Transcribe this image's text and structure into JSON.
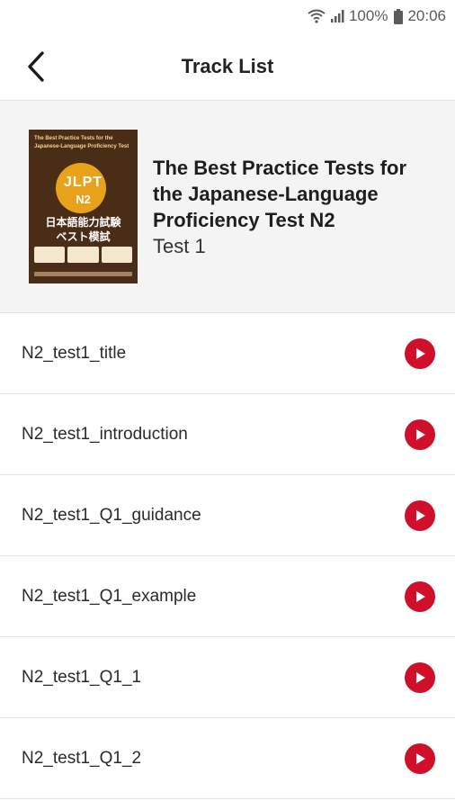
{
  "status_bar": {
    "battery_percent": "100%",
    "time": "20:06",
    "icons": [
      "wifi-icon",
      "signal-icon",
      "battery-icon"
    ]
  },
  "app_bar": {
    "title": "Track List",
    "back_icon": "back-arrow-icon"
  },
  "book": {
    "title": "The Best Practice Tests for the Japanese-Language Proficiency Test N2",
    "subtitle": "Test 1",
    "cover": {
      "top_text": "The Best Practice Tests for the Japanese-Language Proficiency Test",
      "badge": "JLPT",
      "level": "N2",
      "jp_line1": "日本語能力試験",
      "jp_line2": "ベスト模試"
    }
  },
  "tracks": [
    {
      "name": "N2_test1_title"
    },
    {
      "name": "N2_test1_introduction"
    },
    {
      "name": "N2_test1_Q1_guidance"
    },
    {
      "name": "N2_test1_Q1_example"
    },
    {
      "name": "N2_test1_Q1_1"
    },
    {
      "name": "N2_test1_Q1_2"
    }
  ],
  "colors": {
    "accent": "#d0102a",
    "header_bg": "#f4f4f4",
    "cover_bg": "#4a2d17",
    "cover_circle": "#e9a31b"
  }
}
